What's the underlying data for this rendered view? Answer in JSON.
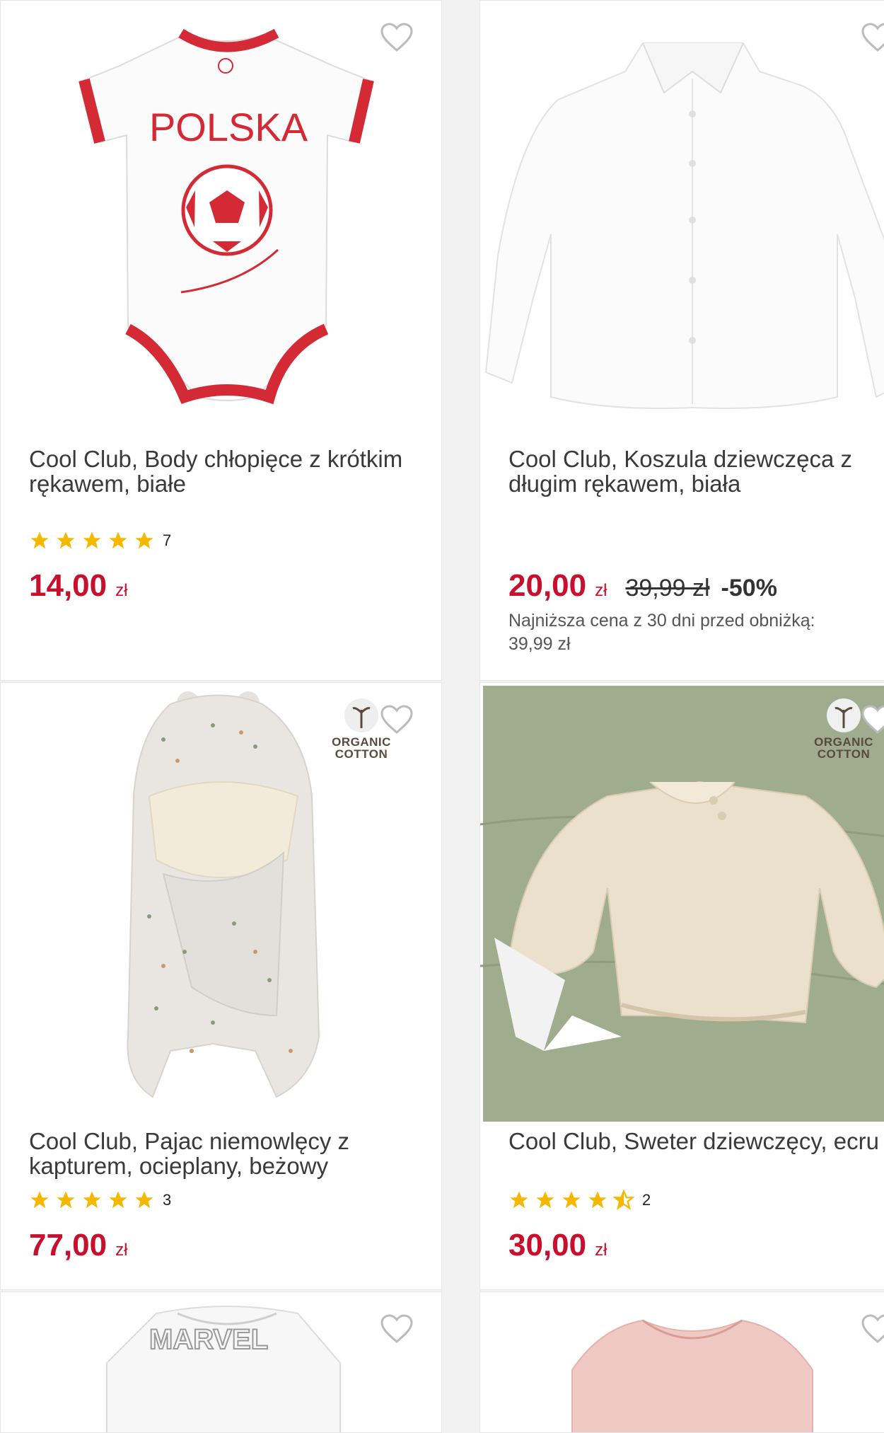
{
  "products": [
    {
      "title": "Cool Club, Body chłopięce z krótkim\nrękawem, białe",
      "print_text": "POLSKA",
      "rating_count": "7",
      "rating": 5,
      "price": "14,00",
      "currency": "zł",
      "wishlist_icon": "heart-outline-icon"
    },
    {
      "title": "Cool Club, Koszula dziewczęca z\ndługim rękawem, biała",
      "price": "20,00",
      "currency": "zł",
      "old_price": "39,99 zł",
      "discount": "-50%",
      "lowest_price_note": "Najniższa cena z 30 dni przed obniżką:\n39,99 zł",
      "wishlist_icon": "heart-outline-icon"
    },
    {
      "title": "Cool Club, Pajac niemowlęcy z\nkapturem, ocieplany, beżowy",
      "badge": {
        "line1": "ORGANIC",
        "line2": "COTTON"
      },
      "rating_count": "3",
      "rating": 5,
      "price": "77,00",
      "currency": "zł",
      "wishlist_icon": "heart-outline-icon"
    },
    {
      "title": "Cool Club, Sweter dziewczęcy, ecru",
      "badge": {
        "line1": "ORGANIC",
        "line2": "COTTON"
      },
      "rating_count": "2",
      "rating": 4.5,
      "price": "30,00",
      "currency": "zł",
      "wishlist_icon": "heart-outline-icon"
    },
    {
      "print_text": "MARVEL",
      "wishlist_icon": "heart-outline-icon"
    },
    {
      "wishlist_icon": "heart-outline-icon"
    }
  ],
  "colors": {
    "price": "#c8102e",
    "star": "#f5b700",
    "accent_red": "#d42a36"
  }
}
